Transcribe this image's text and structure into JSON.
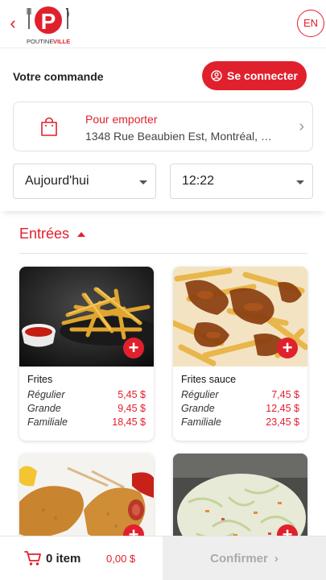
{
  "header": {
    "logo_text_a": "POUTINE",
    "logo_text_b": "VILLE",
    "logo_letter": "P",
    "language": "EN"
  },
  "order": {
    "label": "Votre commande",
    "login_label": "Se connecter",
    "pickup_title": "Pour emporter",
    "pickup_address": "1348 Rue Beaubien Est, Montréal, Q...",
    "date_value": "Aujourd'hui",
    "time_value": "12:22"
  },
  "menu": {
    "section_title": "Entrées",
    "items": [
      {
        "name": "Frites",
        "sizes": [
          {
            "label": "Régulier",
            "price": "5,45 $"
          },
          {
            "label": "Grande",
            "price": "9,45 $"
          },
          {
            "label": "Familiale",
            "price": "18,45 $"
          }
        ]
      },
      {
        "name": "Frites sauce",
        "sizes": [
          {
            "label": "Régulier",
            "price": "7,45 $"
          },
          {
            "label": "Grande",
            "price": "12,45 $"
          },
          {
            "label": "Familiale",
            "price": "23,45 $"
          }
        ]
      }
    ],
    "add_symbol": "+"
  },
  "cart": {
    "count_label": "0 item",
    "total": "0,00 $",
    "confirm_label": "Confirmer",
    "confirm_chevron": "›"
  },
  "colors": {
    "brand": "#e1202d",
    "disabled_bg": "#eeeeee"
  }
}
